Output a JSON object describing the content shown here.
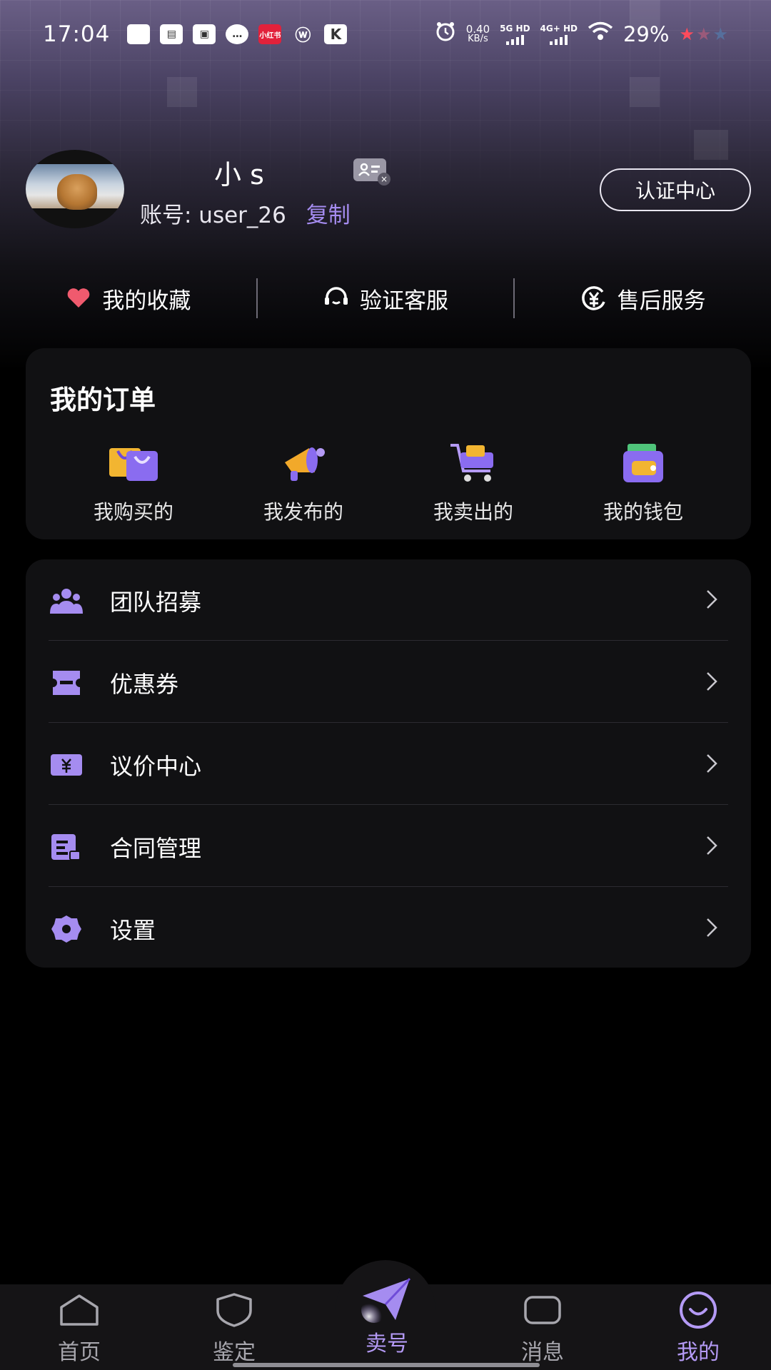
{
  "status_bar": {
    "time": "17:04",
    "net_speed": "0.40",
    "net_unit": "KB/s",
    "sig1": "5G HD",
    "sig2": "4G+ HD",
    "battery": "29%",
    "app_icons": [
      "square-icon",
      "app-badge-icon",
      "book-icon",
      "message-icon",
      "xiaohongshu-icon",
      "weibo-icon",
      "k-icon"
    ],
    "app_red_label": "小红书"
  },
  "profile": {
    "nickname": "小 s",
    "account_label": "账号: user_26",
    "copy_label": "复制",
    "cert_button": "认证中心"
  },
  "quick_links": [
    {
      "label": "我的收藏",
      "icon": "heart-icon"
    },
    {
      "label": "验证客服",
      "icon": "headset-icon"
    },
    {
      "label": "售后服务",
      "icon": "yuan-circle-icon"
    }
  ],
  "orders": {
    "title": "我的订单",
    "items": [
      {
        "label": "我购买的",
        "icon": "shopping-bag-icon"
      },
      {
        "label": "我发布的",
        "icon": "megaphone-icon"
      },
      {
        "label": "我卖出的",
        "icon": "cart-icon"
      },
      {
        "label": "我的钱包",
        "icon": "wallet-icon"
      }
    ]
  },
  "menu": [
    {
      "label": "团队招募",
      "icon": "team-icon"
    },
    {
      "label": "优惠券",
      "icon": "coupon-icon"
    },
    {
      "label": "议价中心",
      "icon": "yuan-ticket-icon"
    },
    {
      "label": "合同管理",
      "icon": "contract-icon"
    },
    {
      "label": "设置",
      "icon": "settings-gear-icon"
    }
  ],
  "nav": [
    {
      "label": "首页",
      "icon": "home-icon"
    },
    {
      "label": "鉴定",
      "icon": "shield-icon"
    },
    {
      "label": "卖号",
      "icon": "send-plane-icon"
    },
    {
      "label": "消息",
      "icon": "message-square-icon"
    },
    {
      "label": "我的",
      "icon": "smile-face-icon"
    }
  ],
  "colors": {
    "accent": "#b49af5",
    "card_bg": "#111113",
    "background": "#000000"
  }
}
